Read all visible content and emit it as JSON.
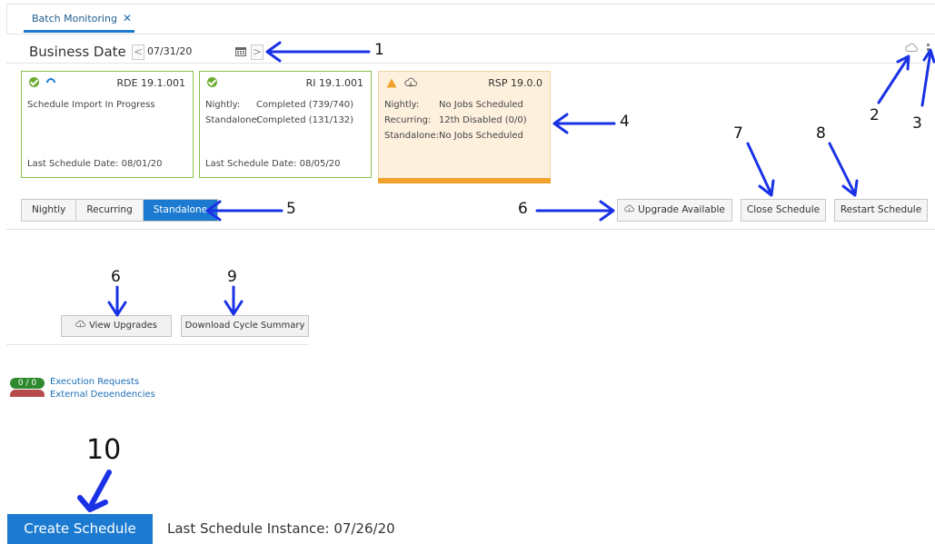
{
  "tab": {
    "label": "Batch Monitoring",
    "close": "✕"
  },
  "business_date": {
    "label": "Business Date",
    "value": "07/31/20",
    "prev": "<",
    "next": ">"
  },
  "cards": [
    {
      "title": "RDE 19.1.001",
      "status": "Schedule Import In Progress",
      "footer": "Last Schedule Date: 08/01/20"
    },
    {
      "title": "RI 19.1.001",
      "rows": [
        {
          "k": "Nightly:",
          "v": "Completed (739/740)"
        },
        {
          "k": "Standalone:",
          "v": "Completed (131/132)"
        }
      ],
      "footer": "Last Schedule Date: 08/05/20"
    },
    {
      "title": "RSP 19.0.0",
      "rows": [
        {
          "k": "Nightly:",
          "v": "No Jobs Scheduled"
        },
        {
          "k": "Recurring:",
          "v": "12th Disabled (0/0)"
        },
        {
          "k": "Standalone:",
          "v": "No Jobs Scheduled"
        }
      ]
    }
  ],
  "segments": [
    "Nightly",
    "Recurring",
    "Standalone"
  ],
  "actions": {
    "upgrade": "Upgrade Available",
    "close": "Close Schedule",
    "restart": "Restart Schedule"
  },
  "lower": {
    "view_upgrades": "View Upgrades",
    "download_summary": "Download Cycle Summary",
    "exec_count": "0 / 0",
    "exec_label": "Execution Requests",
    "ext_label": "External Dependencies"
  },
  "create": {
    "label": "Create Schedule",
    "last_instance": "Last Schedule Instance: 07/26/20"
  },
  "annotations": [
    "1",
    "2",
    "3",
    "4",
    "5",
    "6",
    "7",
    "8",
    "6",
    "9",
    "10"
  ],
  "colors": {
    "accent": "#1c7bd0",
    "ok": "#6cab2f",
    "warn": "#f0a22a",
    "arrow": "#1a32e6"
  }
}
